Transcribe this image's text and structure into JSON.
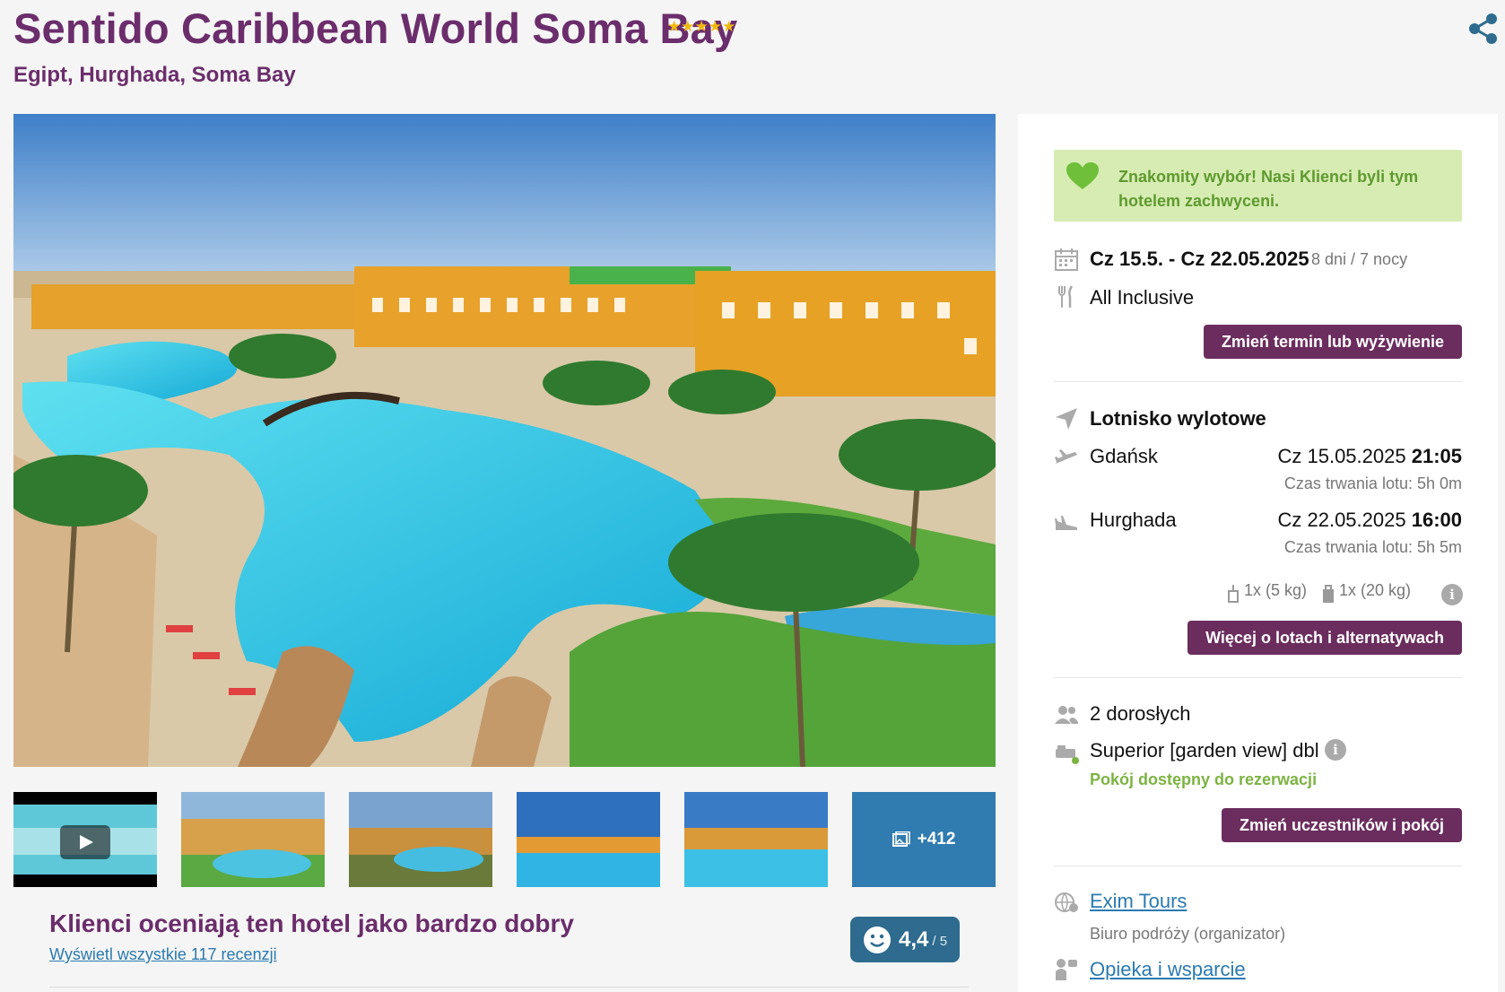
{
  "header": {
    "title": "Sentido Caribbean World Soma Bay",
    "stars": "★★★★★",
    "location": "Egipt, Hurghada, Soma Bay"
  },
  "gallery": {
    "more_count": "+412",
    "icons": {
      "share": "share-icon",
      "play": "play-icon",
      "gallery": "images-icon"
    }
  },
  "reviews": {
    "title": "Klienci oceniają ten hotel jako bardzo dobry",
    "link": "Wyświetl wszystkie 117 recenzji",
    "score": "4,4",
    "score_max": "/ 5"
  },
  "sidebar": {
    "notice": "Znakomity wybór! Nasi Klienci byli tym hotelem zachwyceni.",
    "dates": "Cz 15.5. - Cz 22.05.2025",
    "duration": "8 dni / 7 nocy",
    "board": "All Inclusive",
    "change_date_button": "Zmień termin lub wyżywienie",
    "airport_heading": "Lotnisko wylotowe",
    "outbound": {
      "city": "Gdańsk",
      "date": "Cz 15.05.2025",
      "time": "21:05",
      "flight_time": "Czas trwania lotu: 5h 0m"
    },
    "return": {
      "city": "Hurghada",
      "date": "Cz 22.05.2025",
      "time": "16:00",
      "flight_time": "Czas trwania lotu: 5h 5m"
    },
    "baggage_hand": "1x (5 kg)",
    "baggage_checked": "1x (20 kg)",
    "flights_button": "Więcej o lotach i alternatywach",
    "travellers": "2 dorosłych",
    "room": "Superior [garden view] dbl",
    "room_status": "Pokój dostępny do rezerwacji",
    "change_room_button": "Zmień uczestników i pokój",
    "organizer_name": "Exim Tours",
    "organizer_role": "Biuro podróży (organizator)",
    "support_link": "Opieka i wsparcie"
  },
  "colors": {
    "brand_purple": "#6b2d6b",
    "button_purple": "#6b2d5e",
    "notice_bg": "#d7ecb3",
    "notice_text": "#5e9a2e",
    "link_blue": "#2a7ab0",
    "star_gold": "#f2b90c",
    "available_green": "#7cb342",
    "rating_badge": "#2e6b8f"
  }
}
